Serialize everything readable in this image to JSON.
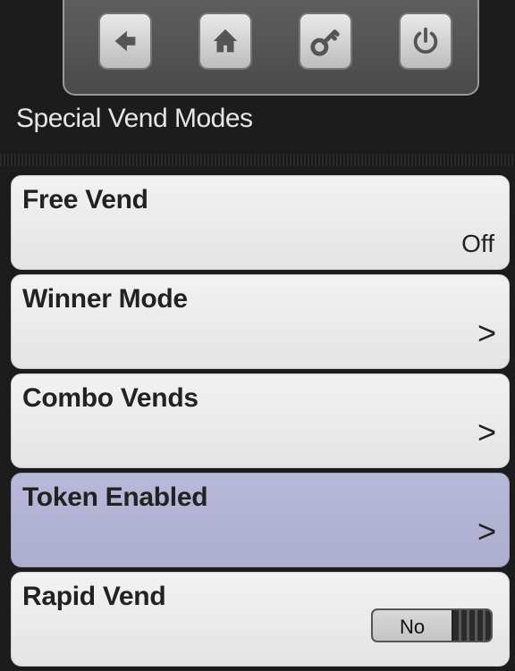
{
  "nav": {
    "back_icon": "back-arrow-icon",
    "home_icon": "home-icon",
    "key_icon": "key-icon",
    "power_icon": "power-icon"
  },
  "header": {
    "title": "Special Vend Modes"
  },
  "menu": {
    "items": [
      {
        "label": "Free Vend",
        "value": "Off"
      },
      {
        "label": "Winner Mode",
        "chevron": ">"
      },
      {
        "label": "Combo Vends",
        "chevron": ">"
      },
      {
        "label": "Token Enabled",
        "chevron": ">",
        "selected": true
      },
      {
        "label": "Rapid Vend",
        "toggle_text": "No"
      }
    ]
  },
  "colors": {
    "selected_row": "#b2b3d3",
    "row": "#ececec",
    "background": "#1c1c1c"
  }
}
